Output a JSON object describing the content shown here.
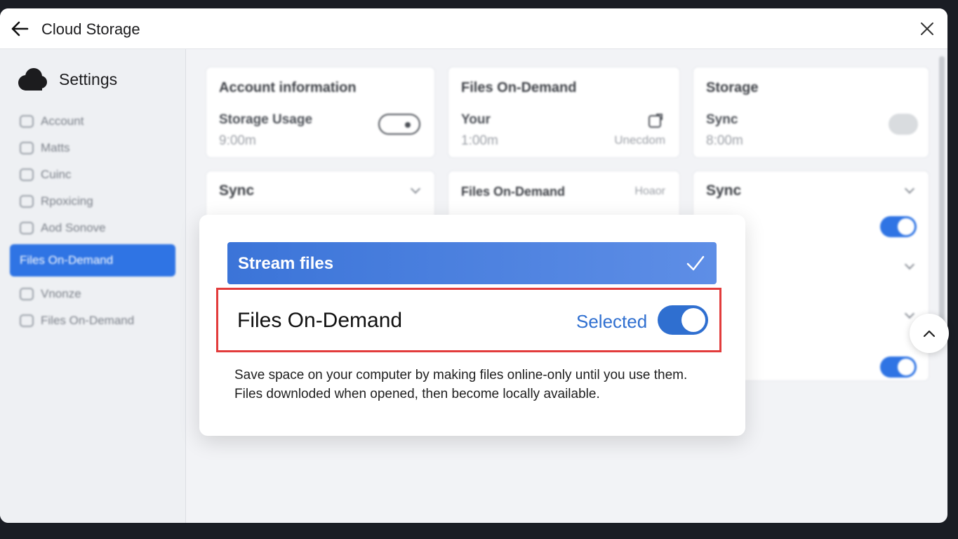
{
  "window": {
    "title": "Cloud Storage",
    "back_icon": "arrow-left-icon",
    "close_icon": "close-icon"
  },
  "sidebar": {
    "title": "Settings",
    "items": [
      {
        "label": "Account",
        "icon": "account-icon",
        "active": false
      },
      {
        "label": "Matts",
        "icon": "grid-icon",
        "active": false
      },
      {
        "label": "Cuinc",
        "icon": "cloud-icon",
        "active": false
      },
      {
        "label": "Rpoxicing",
        "icon": "box-icon",
        "active": false
      },
      {
        "label": "Aod Sonove",
        "icon": "tag-icon",
        "active": false
      },
      {
        "label": "Files On-Demand",
        "icon": "",
        "active": true
      },
      {
        "label": "Vnonze",
        "icon": "gear-icon",
        "active": false
      },
      {
        "label": "Files On-Demand",
        "icon": "file-icon",
        "active": false
      }
    ]
  },
  "cards": {
    "account": {
      "heading": "Account information",
      "sub": "Storage Usage",
      "value": "9:00m"
    },
    "fod": {
      "heading": "Files On-Demand",
      "sub": "Your",
      "value": "1:00m",
      "right": "Unecdom"
    },
    "storage": {
      "heading": "Storage",
      "sub": "Sync",
      "value": "8:00m"
    },
    "sync_left": {
      "heading": "Sync"
    },
    "fod_mid": {
      "heading": "Files On-Demand",
      "right": "Hoaor"
    },
    "sync_right": {
      "heading": "Sync"
    }
  },
  "popover": {
    "stream_label": "Stream files",
    "option_label": "Files On-Demand",
    "option_status": "Selected",
    "toggle_on": true,
    "description_line1": "Save space on your computer by making files online-only until you use them.",
    "description_line2": "Files downloded when opened, then become locally available."
  },
  "colors": {
    "accent": "#2f6fd0",
    "highlight": "#e23b3b"
  }
}
